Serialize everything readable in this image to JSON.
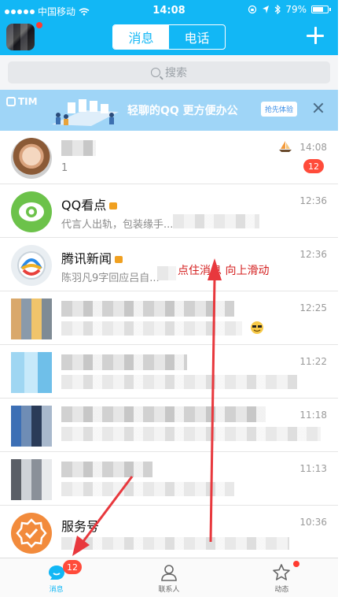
{
  "status_bar": {
    "carrier": "中国移动",
    "time": "14:08",
    "battery_percent": "79%",
    "battery_level": 0.79
  },
  "header": {
    "tabs": [
      {
        "label": "消息",
        "active": true
      },
      {
        "label": "电话",
        "active": false
      }
    ],
    "accent_color": "#12b7f5"
  },
  "search": {
    "placeholder": "搜索"
  },
  "banner": {
    "logo": "TIM",
    "text": "轻聊的QQ 更方便办公",
    "button": "抢先体验"
  },
  "conversations": [
    {
      "name": "",
      "preview": "1",
      "time": "14:08",
      "badge": "12",
      "avatar": "baby-photo"
    },
    {
      "name": "QQ看点",
      "preview": "代言人出轨，包装缘手...",
      "time": "12:36",
      "avatar": "eye-logo"
    },
    {
      "name": "腾讯新闻",
      "preview": "陈羽凡9字回应吕自...",
      "time": "12:36",
      "avatar": "tencent-news-logo"
    },
    {
      "name": "",
      "preview": "",
      "time": "12:25",
      "avatar": "blurred"
    },
    {
      "name": "",
      "preview": "",
      "time": "11:22",
      "avatar": "blurred"
    },
    {
      "name": "",
      "preview": "",
      "time": "11:18",
      "avatar": "blurred"
    },
    {
      "name": "",
      "preview": "",
      "time": "11:13",
      "avatar": "blurred"
    },
    {
      "name": "服务号",
      "preview": "",
      "time": "10:36",
      "avatar": "service-logo"
    }
  ],
  "tabbar": {
    "items": [
      {
        "label": "消息",
        "badge": "12",
        "active": true
      },
      {
        "label": "联系人",
        "active": false
      },
      {
        "label": "动态",
        "dot": true,
        "active": false
      }
    ]
  },
  "annotation": {
    "text": "点住消息 向上滑动",
    "color": "#d42020"
  }
}
